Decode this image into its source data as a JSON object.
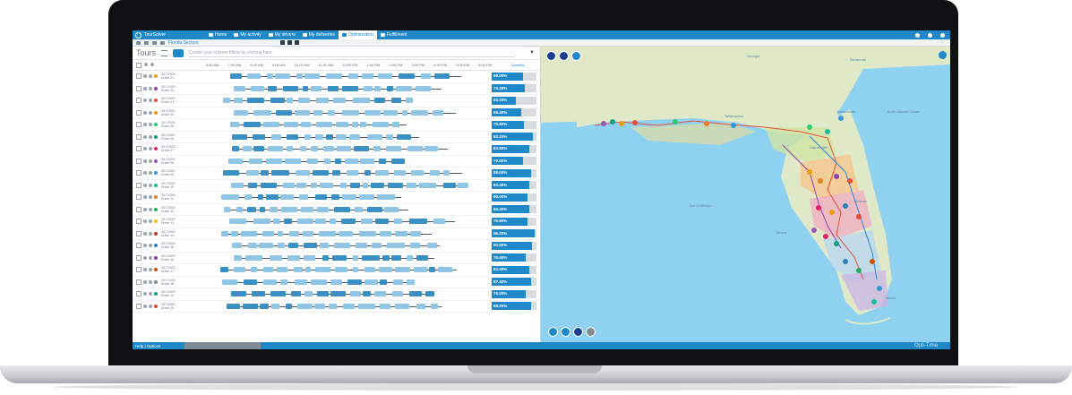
{
  "app": {
    "name": "TourSolver"
  },
  "nav": [
    {
      "label": "Home",
      "active": false
    },
    {
      "label": "My activity",
      "active": false
    },
    {
      "label": "My drivers",
      "active": false
    },
    {
      "label": "My deliveries",
      "active": false
    },
    {
      "label": "Optimization",
      "active": true
    },
    {
      "label": "Fulfillment",
      "active": false
    }
  ],
  "subbar": {
    "title": "Florida Sectors"
  },
  "toolbar": {
    "tours_label": "Tours",
    "filter_placeholder": "Create your custom filters by clicking here"
  },
  "time_header": {
    "times": [
      "6:00 AM",
      "7:00 AM",
      "8:00 AM",
      "9:00 AM",
      "10:00 AM",
      "11:00 AM",
      "12:00 PM",
      "1:00 PM",
      "2:00 PM",
      "3:00 PM",
      "4:00 PM",
      "5:00 PM",
      "6:00 PM"
    ],
    "quantity_label": "Quantity"
  },
  "rows": [
    {
      "date": "3/17/2020",
      "driver": "Driver 01",
      "qty": "69.00%",
      "fill": 0.69,
      "color": "#f39c12"
    },
    {
      "date": "3/17/2020",
      "driver": "Driver 02",
      "qty": "74.29%",
      "fill": 0.74,
      "color": "#8e44ad"
    },
    {
      "date": "3/17/2020",
      "driver": "Driver 03",
      "qty": "53.20%",
      "fill": 0.53,
      "color": "#e74c3c"
    },
    {
      "date": "3/17/2020",
      "driver": "Driver 04",
      "qty": "65.40%",
      "fill": 0.65,
      "color": "#f39c12"
    },
    {
      "date": "3/17/2020",
      "driver": "Driver 05",
      "qty": "70.80%",
      "fill": 0.71,
      "color": "#2ecc71"
    },
    {
      "date": "3/17/2020",
      "driver": "Driver 06",
      "qty": "92.20%",
      "fill": 0.92,
      "color": "#16a085"
    },
    {
      "date": "3/17/2020",
      "driver": "Driver 07",
      "qty": "82.60%",
      "fill": 0.83,
      "color": "#e91e63"
    },
    {
      "date": "3/17/2020",
      "driver": "Driver 08",
      "qty": "70.00%",
      "fill": 0.7,
      "color": "#9b59b6"
    },
    {
      "date": "3/17/2020",
      "driver": "Driver 09",
      "qty": "88.00%",
      "fill": 0.88,
      "color": "#3498db"
    },
    {
      "date": "3/17/2020",
      "driver": "Driver 10",
      "qty": "83.40%",
      "fill": 0.83,
      "color": "#1abc9c"
    },
    {
      "date": "3/17/2020",
      "driver": "Driver 11",
      "qty": "80.00%",
      "fill": 0.8,
      "color": "#e67e22"
    },
    {
      "date": "3/17/2020",
      "driver": "Driver 12",
      "qty": "84.40%",
      "fill": 0.84,
      "color": "#27ae60"
    },
    {
      "date": "3/17/2020",
      "driver": "Driver 13",
      "qty": "79.80%",
      "fill": 0.8,
      "color": "#f1c40f"
    },
    {
      "date": "3/17/2020",
      "driver": "Driver 14",
      "qty": "96.20%",
      "fill": 0.96,
      "color": "#c0392b"
    },
    {
      "date": "3/17/2020",
      "driver": "Driver 15",
      "qty": "90.00%",
      "fill": 0.9,
      "color": "#2980b9"
    },
    {
      "date": "3/17/2020",
      "driver": "Driver 16",
      "qty": "75.40%",
      "fill": 0.75,
      "color": "#8e44ad"
    },
    {
      "date": "3/17/2020",
      "driver": "Driver 17",
      "qty": "84.40%",
      "fill": 0.84,
      "color": "#d35400"
    },
    {
      "date": "3/17/2020",
      "driver": "Driver 18",
      "qty": "87.40%",
      "fill": 0.87,
      "color": "#7f8c8d"
    },
    {
      "date": "3/17/2020",
      "driver": "Driver 19",
      "qty": "76.00%",
      "fill": 0.76,
      "color": "#16a085"
    },
    {
      "date": "3/17/2020",
      "driver": "Driver 20",
      "qty": "88.00%",
      "fill": 0.88,
      "color": "#e74c3c"
    }
  ],
  "map": {
    "labels": [
      "Georgia",
      "Savannah",
      "Jacksonville",
      "Orlando",
      "Tampa",
      "Miami",
      "Gulf of Mexico",
      "North Atlantic Ocean",
      "Tallahassee",
      "Gainesville"
    ]
  },
  "footer": {
    "help": "Help | Options",
    "brand": "Opti-Time"
  },
  "colors": {
    "primary": "#1e88c8",
    "bezel": "#0f1012",
    "water": "#8fd1f1",
    "land": "#dfe9c8"
  }
}
